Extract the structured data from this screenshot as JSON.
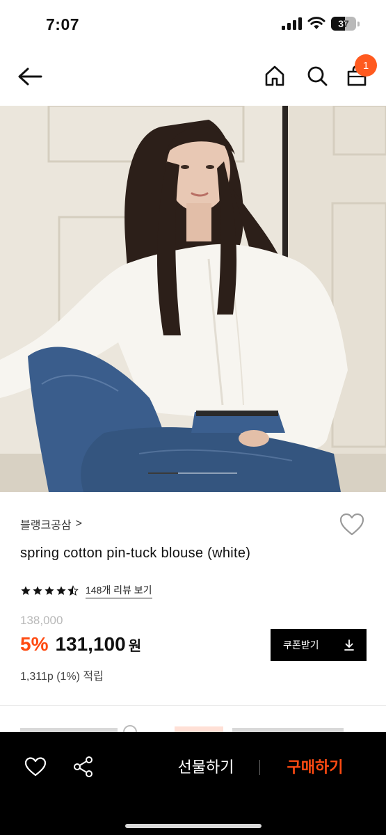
{
  "status": {
    "time": "7:07",
    "battery": "37"
  },
  "nav": {
    "cart_count": "1"
  },
  "product": {
    "brand": "블랭크공삼",
    "brand_chevron": ">",
    "title": "spring cotton pin-tuck blouse (white)",
    "rating": 4.5,
    "review_link": "148개 리뷰 보기",
    "original_price": "138,000",
    "discount": "5%",
    "sale_price": "131,100",
    "currency": "원",
    "points": "1,311p (1%) 적립",
    "coupon_label": "쿠폰받기"
  },
  "carousel": {
    "current": 1,
    "total": 3
  },
  "bottom_bar": {
    "gift_label": "선물하기",
    "buy_label": "구매하기"
  },
  "colors": {
    "accent": "#ff4b12",
    "badge": "#ff5a1f",
    "bar_bg": "#000000"
  },
  "icons": [
    "back-arrow-icon",
    "home-icon",
    "search-icon",
    "shopping-bag-icon",
    "heart-outline-icon",
    "star-icon",
    "download-icon",
    "share-icon"
  ]
}
